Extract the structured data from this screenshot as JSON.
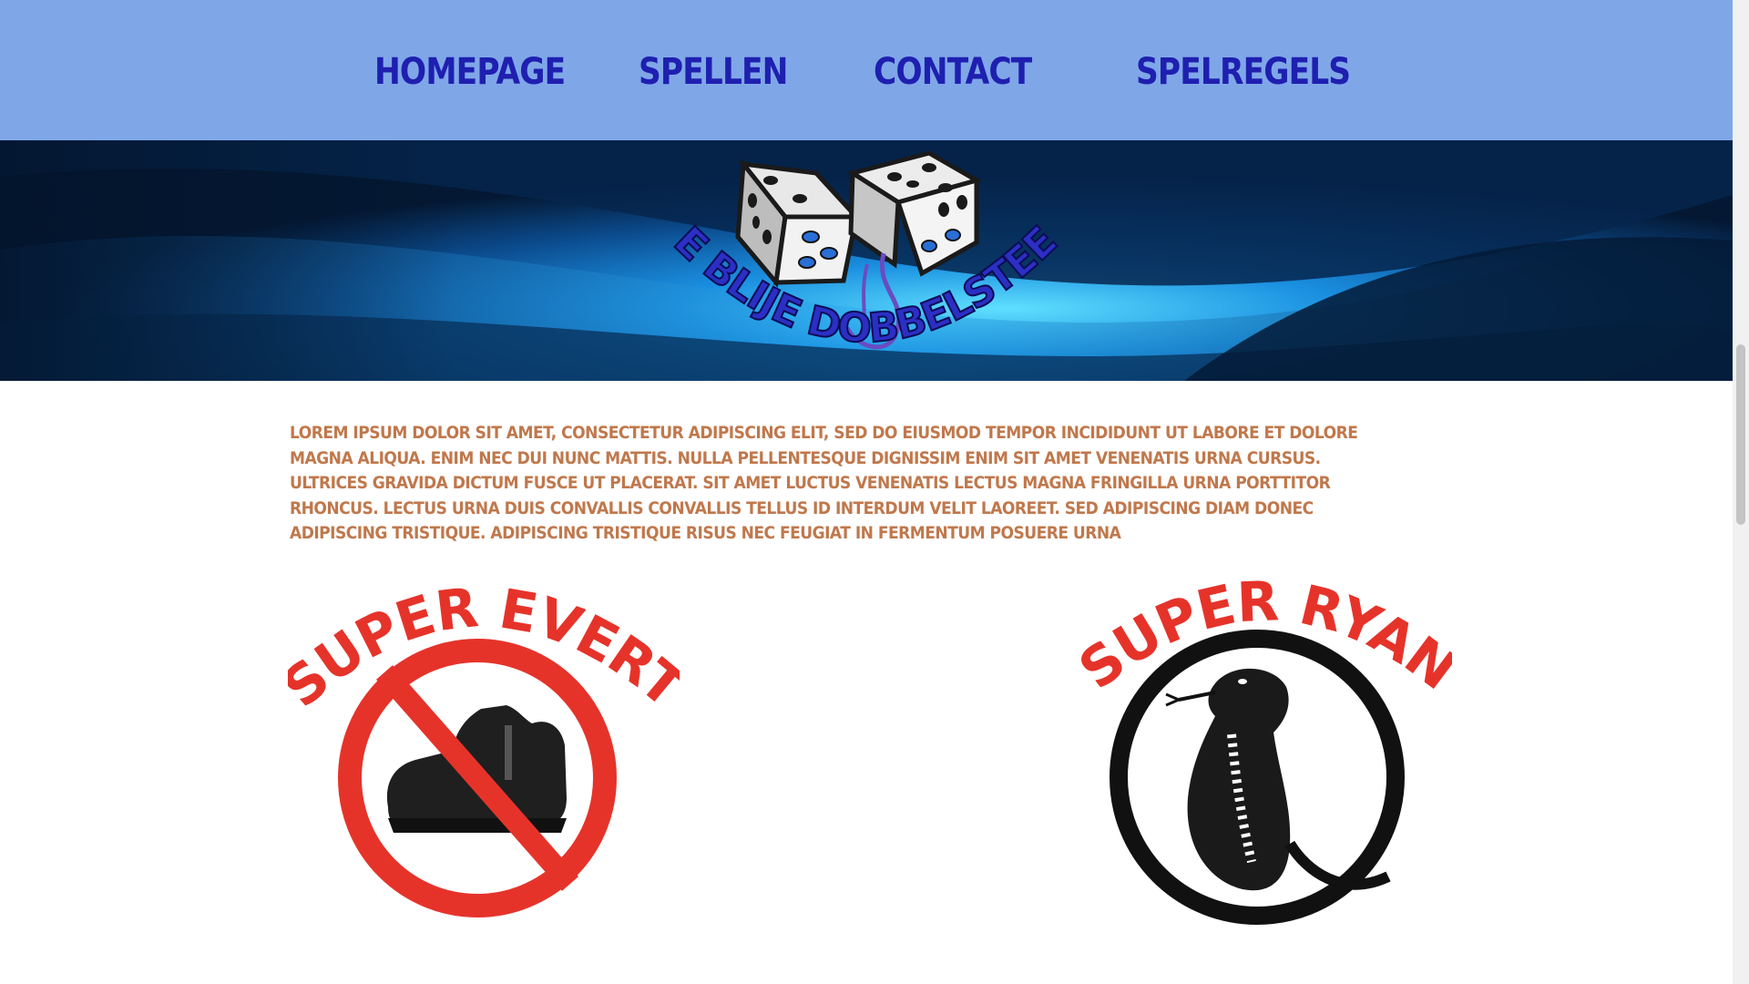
{
  "nav": {
    "items": [
      {
        "label": "Homepage"
      },
      {
        "label": "Spellen"
      },
      {
        "label": "Contact"
      },
      {
        "label": "Spelregels"
      }
    ]
  },
  "hero": {
    "logo_text": "DE BLIJE DOBBELSTEEN",
    "logo_icon": "dice-with-eyes"
  },
  "intro": {
    "text": "Lorem ipsum dolor sit amet, consectetur adipiscing elit, sed do eiusmod tempor incididunt ut labore et dolore magna aliqua. Enim nec dui nunc mattis. Nulla pellentesque dignissim enim sit amet venenatis urna cursus. Ultrices gravida dictum fusce ut placerat. Sit amet luctus venenatis lectus magna fringilla urna porttitor rhoncus. Lectus urna duis convallis convallis tellus id interdum velit laoreet. Sed adipiscing diam donec adipiscing tristique. Adipiscing tristique risus nec feugiat in fermentum posuere urna"
  },
  "logos": [
    {
      "title": "SUPER EVERT",
      "icon": "no-boot-icon"
    },
    {
      "title": "SUPER RYAN",
      "icon": "cobra-icon"
    }
  ],
  "colors": {
    "nav_bg": "#7fa7e8",
    "nav_text": "#1f1fb0",
    "body_text": "#c0784c",
    "logo_red": "#e6332a"
  }
}
